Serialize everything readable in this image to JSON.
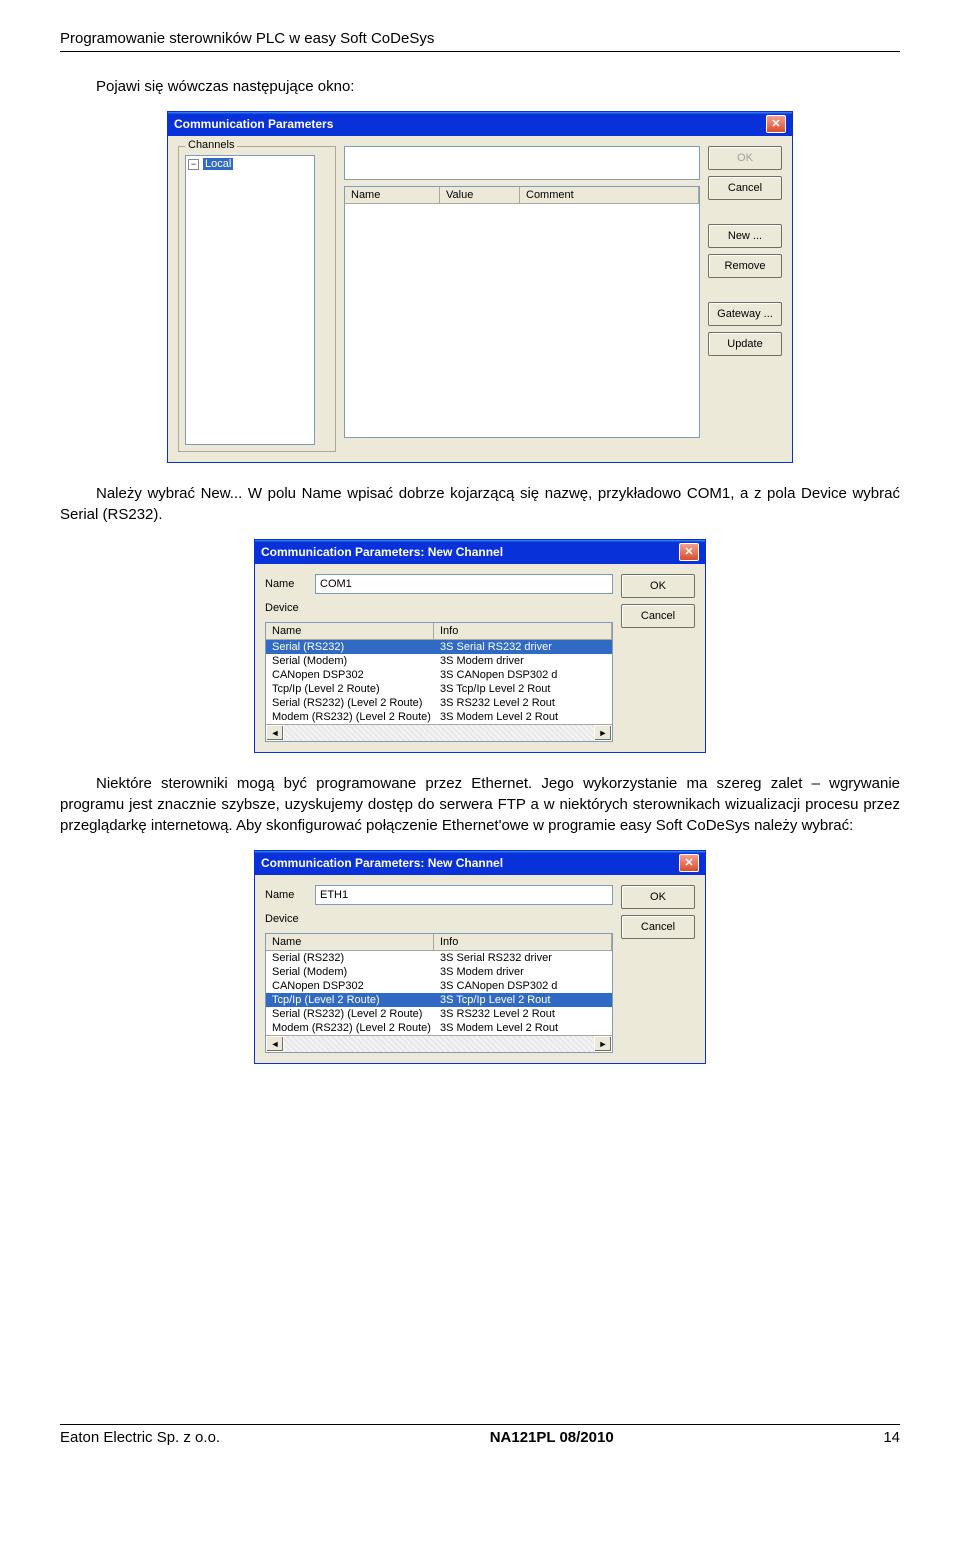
{
  "page_header": "Programowanie sterowników PLC w easy Soft CoDeSys",
  "intro": "Pojawi się wówczas następujące okno:",
  "paragraph_1": "Należy wybrać New... W polu Name wpisać dobrze kojarzącą się nazwę, przykładowo COM1, a z pola Device wybrać Serial (RS232).",
  "paragraph_2": "Niektóre sterowniki mogą być programowane przez Ethernet. Jego wykorzystanie ma szereg zalet – wgrywanie programu jest znacznie szybsze, uzyskujemy dostęp do serwera FTP a w niektórych sterownikach wizualizacji procesu przez przeglądarkę internetową. Aby skonfigurować połączenie Ethernet'owe w programie easy Soft CoDeSys należy wybrać:",
  "dialog1": {
    "title": "Communication Parameters",
    "channels_label": "Channels",
    "tree_root": "Local",
    "columns": {
      "name": "Name",
      "value": "Value",
      "comment": "Comment"
    },
    "buttons": {
      "ok": "OK",
      "cancel": "Cancel",
      "new": "New ...",
      "remove": "Remove",
      "gateway": "Gateway ...",
      "update": "Update"
    }
  },
  "dialog2": {
    "title": "Communication Parameters: New Channel",
    "labels": {
      "name": "Name",
      "device": "Device"
    },
    "name_value": "COM1",
    "columns": {
      "name": "Name",
      "info": "Info"
    },
    "buttons": {
      "ok": "OK",
      "cancel": "Cancel"
    },
    "devices": [
      {
        "name": "Serial (RS232)",
        "info": "3S Serial RS232 driver"
      },
      {
        "name": "Serial (Modem)",
        "info": "3S Modem driver"
      },
      {
        "name": "CANopen DSP302",
        "info": "3S CANopen DSP302 d"
      },
      {
        "name": "Tcp/Ip (Level 2 Route)",
        "info": "3S Tcp/Ip Level 2 Rout"
      },
      {
        "name": "Serial (RS232) (Level 2 Route)",
        "info": "3S RS232 Level 2 Rout"
      },
      {
        "name": "Modem (RS232) (Level 2 Route)",
        "info": "3S Modem Level 2 Rout"
      }
    ],
    "selected_index": 0
  },
  "dialog3": {
    "title": "Communication Parameters: New Channel",
    "labels": {
      "name": "Name",
      "device": "Device"
    },
    "name_value": "ETH1",
    "columns": {
      "name": "Name",
      "info": "Info"
    },
    "buttons": {
      "ok": "OK",
      "cancel": "Cancel"
    },
    "devices": [
      {
        "name": "Serial (RS232)",
        "info": "3S Serial RS232 driver"
      },
      {
        "name": "Serial (Modem)",
        "info": "3S Modem driver"
      },
      {
        "name": "CANopen DSP302",
        "info": "3S CANopen DSP302 d"
      },
      {
        "name": "Tcp/Ip (Level 2 Route)",
        "info": "3S Tcp/Ip Level 2 Rout"
      },
      {
        "name": "Serial (RS232) (Level 2 Route)",
        "info": "3S RS232 Level 2 Rout"
      },
      {
        "name": "Modem (RS232) (Level 2 Route)",
        "info": "3S Modem Level 2 Rout"
      }
    ],
    "selected_index": 3
  },
  "footer": {
    "left": "Eaton Electric Sp. z o.o.",
    "center": "NA121PL 08/2010",
    "right": "14"
  }
}
